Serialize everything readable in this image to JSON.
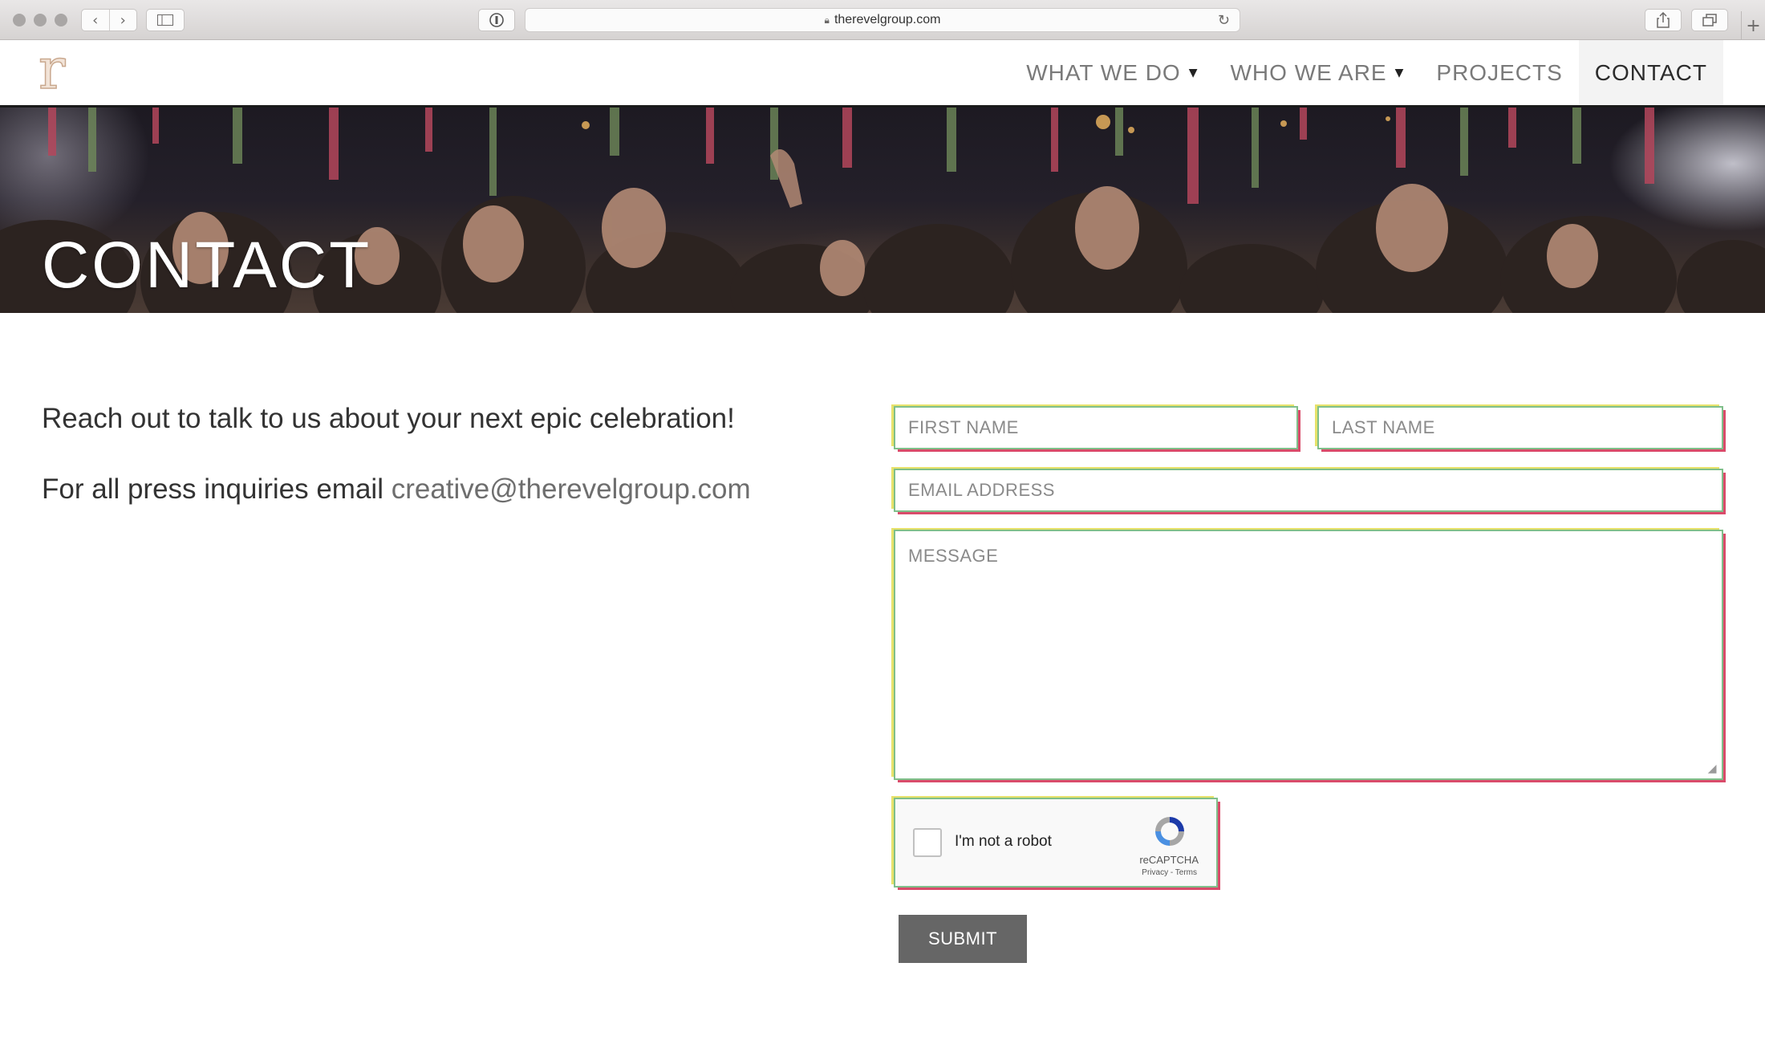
{
  "browser": {
    "url": "therevelgroup.com",
    "icons": {
      "back": "chevron-left-icon",
      "forward": "chevron-right-icon",
      "sidebar": "sidebar-icon",
      "password": "password-manager-icon",
      "lock": "lock-icon",
      "reload": "reload-icon",
      "share": "share-icon",
      "tabs": "tabs-icon",
      "new_tab": "plus-icon"
    }
  },
  "site": {
    "logo_letter": "r",
    "nav": [
      {
        "label": "WHAT WE DO",
        "has_dropdown": true
      },
      {
        "label": "WHO WE ARE",
        "has_dropdown": true
      },
      {
        "label": "PROJECTS",
        "has_dropdown": false
      },
      {
        "label": "CONTACT",
        "has_dropdown": false,
        "active": true
      }
    ]
  },
  "hero": {
    "title": "CONTACT"
  },
  "content": {
    "intro": "Reach out to talk to us about your next epic celebration!",
    "press_prefix": "For all press inquiries email ",
    "press_email": "creative@therevelgroup.com"
  },
  "form": {
    "first_name_placeholder": "FIRST NAME",
    "last_name_placeholder": "LAST NAME",
    "email_placeholder": "EMAIL ADDRESS",
    "message_placeholder": "MESSAGE",
    "captcha_label": "I'm not a robot",
    "captcha_brand": "reCAPTCHA",
    "captcha_links": "Privacy - Terms",
    "submit_label": "SUBMIT"
  },
  "colors": {
    "nav_text": "#7a7a7a",
    "nav_active_bg": "#f3f3f3",
    "submit_bg": "#666666",
    "body_text": "#333333",
    "email_link": "#6e6e6e"
  }
}
